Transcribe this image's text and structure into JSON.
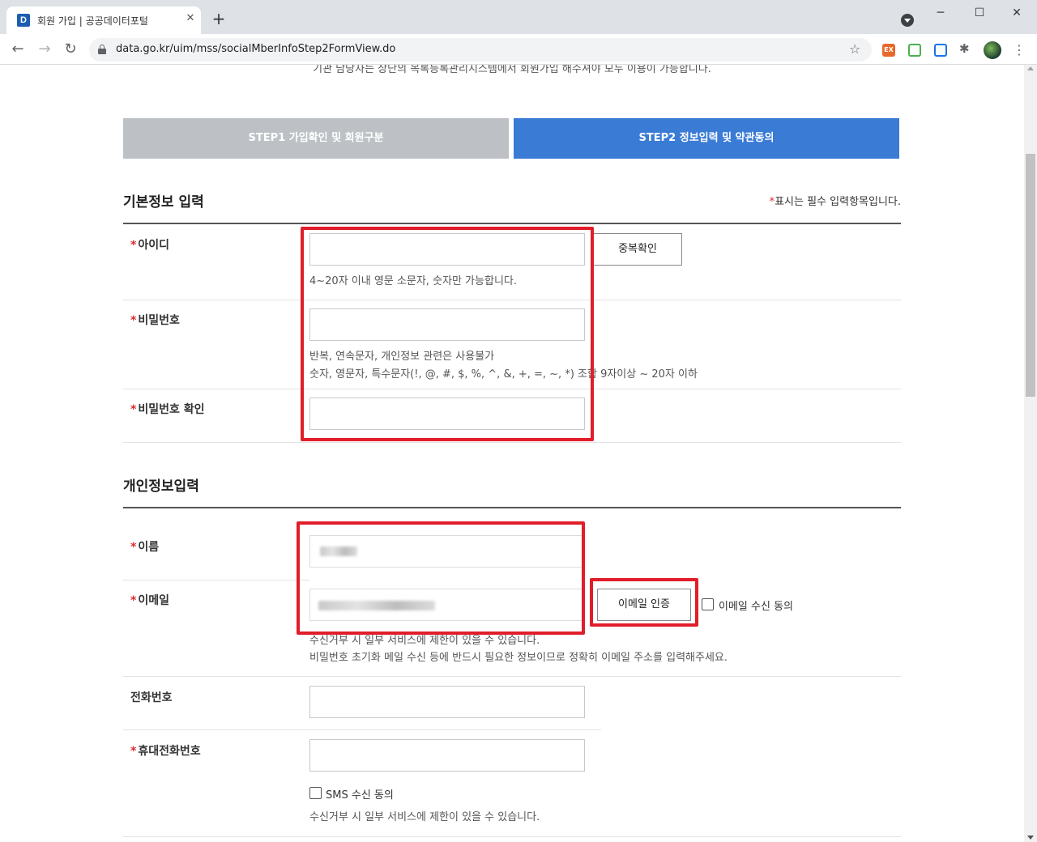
{
  "browser": {
    "tab_title": "회원 가입 | 공공데이터포털",
    "tab_favicon_letter": "D",
    "new_tab_symbol": "+",
    "close_symbol": "✕",
    "url": "data.go.kr/uim/mss/socialMberInfoStep2FormView.do",
    "window_controls": {
      "minimize": "─",
      "maximize": "☐",
      "close": "✕"
    }
  },
  "page": {
    "top_notice": "기관 담당자는 상단의 목록등록관리시스템에서 회원가입 해주셔야 모두 이용이 가능합니다.",
    "steps": [
      {
        "label": "STEP1  가입확인 및 회원구분",
        "active": false
      },
      {
        "label": "STEP2  정보입력 및 약관동의",
        "active": true
      }
    ],
    "basic_section": {
      "title": "기본정보 입력",
      "required_note_star": "*",
      "required_note": "표시는 필수 입력항목입니다.",
      "id_label": "아이디",
      "id_help": "4~20자 이내 영문 소문자, 숫자만 가능합니다.",
      "id_check_button": "중복확인",
      "password_label": "비밀번호",
      "password_help_1": "반복, 연속문자, 개인정보 관련은 사용불가",
      "password_help_2": "숫자, 영문자, 특수문자(!, @, #, $, %, ^, &, +, =, ~, *) 조합 9자이상 ~ 20자 이하",
      "password_confirm_label": "비밀번호 확인"
    },
    "personal_section": {
      "title": "개인정보입력",
      "name_label": "이름",
      "email_label": "이메일",
      "email_verify_button": "이메일 인증",
      "email_consent_label": "이메일 수신 동의",
      "email_help_1": "수신거부 시 일부 서비스에 제한이 있을 수 있습니다.",
      "email_help_2": "비밀번호 초기화 메일 수신 등에 반드시 필요한 정보이므로 정확히 이메일 주소를 입력해주세요.",
      "phone_label": "전화번호",
      "mobile_label": "휴대전화번호",
      "sms_consent_label": "SMS 수신 동의",
      "sms_help": "수신거부 시 일부 서비스에 제한이 있을 수 있습니다."
    },
    "required_star": "*"
  },
  "colors": {
    "step_inactive": "#bdc1c6",
    "step_active": "#3a7bd5",
    "required_star": "#e0292f",
    "highlight_box": "#e01e2a"
  }
}
